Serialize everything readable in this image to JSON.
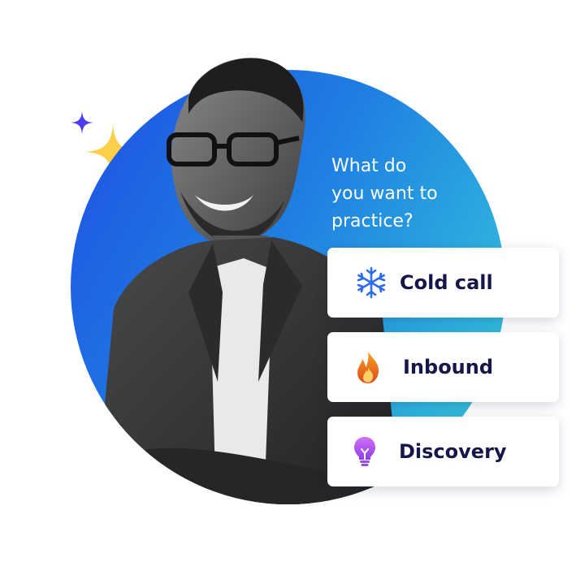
{
  "prompt": {
    "lines": [
      "What do",
      "you want to",
      "practice?"
    ]
  },
  "options": [
    {
      "label": "Cold call",
      "icon": "snowflake-icon",
      "color": "#2f6bf0"
    },
    {
      "label": "Inbound",
      "icon": "flame-icon",
      "color": "#f07a18"
    },
    {
      "label": "Discovery",
      "icon": "lightbulb-icon",
      "color": "#b04bf0"
    }
  ],
  "colors": {
    "circle_start": "#1f4fe4",
    "circle_end": "#3cc4da",
    "sparkle_large": "#ffcf4a",
    "sparkle_small": "#4a3cf0",
    "label_text": "#15174a"
  }
}
